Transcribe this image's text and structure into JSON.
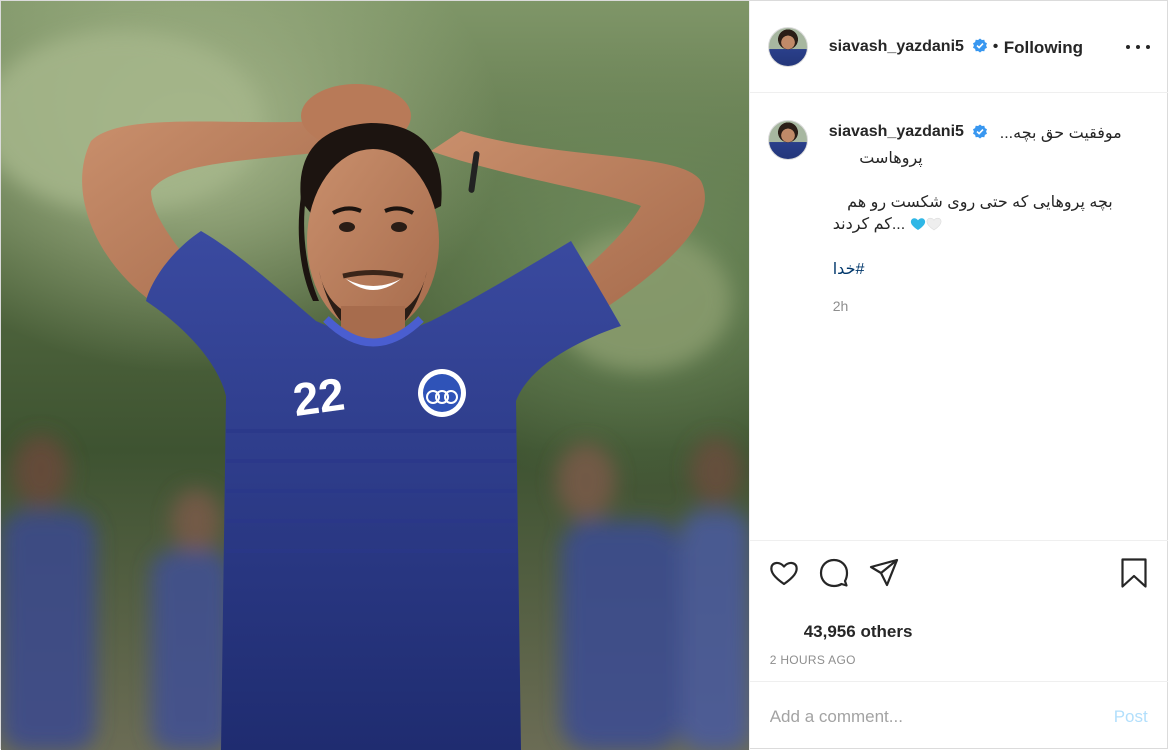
{
  "header": {
    "username": "siavash_yazdani5",
    "separator": "•",
    "follow_status": "Following"
  },
  "caption": {
    "username": "siavash_yazdani5",
    "line1": "موفقیت حق بچه...",
    "line2": "پروهاست",
    "line3": "بچه پروهایی که حتی روی شکست رو هم",
    "line4": "...کم کردند",
    "hashtag": "#خدا",
    "relative_time": "2h"
  },
  "photo": {
    "jersey_number": "22"
  },
  "stats": {
    "likes": "43,956 others",
    "posted": "2 HOURS AGO"
  },
  "comment": {
    "placeholder": "Add a comment...",
    "post_label": "Post"
  },
  "icons": {
    "verified": "verified-badge-icon",
    "more": "more-options-icon",
    "like": "heart-icon",
    "comment": "comment-bubble-icon",
    "share": "paper-plane-icon",
    "save": "bookmark-icon"
  },
  "colors": {
    "verified_blue": "#3897f0",
    "link": "#00376b",
    "post_button_disabled": "#b2dffc",
    "muted": "#8e8e8e",
    "jersey": "#2b3a86"
  }
}
